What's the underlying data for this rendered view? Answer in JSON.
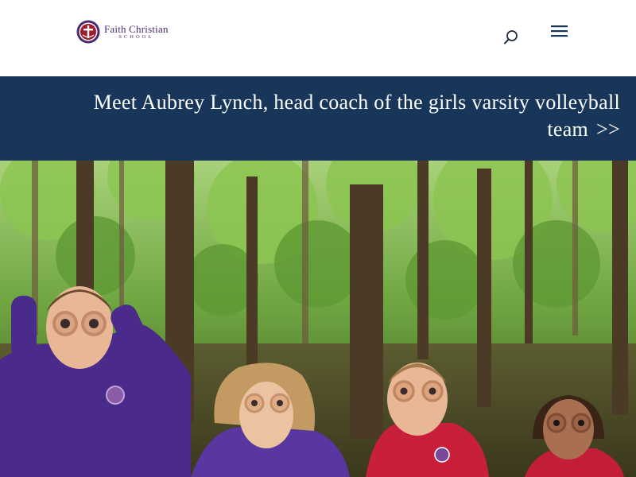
{
  "header": {
    "logo": {
      "name": "Faith Christian",
      "sub": "SCHOOL"
    },
    "icons": {
      "search": "search-icon",
      "menu": "hamburger-menu-icon"
    }
  },
  "banner": {
    "text": "Meet Aubrey Lynch, head coach of the girls varsity volleyball team",
    "arrow": ">>",
    "background": "#18365a"
  },
  "hero": {
    "description_icon": "photo-children-in-forest"
  },
  "colors": {
    "brand_purple": "#4b2a6e",
    "brand_red": "#a01c2c",
    "banner_navy": "#18365a"
  }
}
